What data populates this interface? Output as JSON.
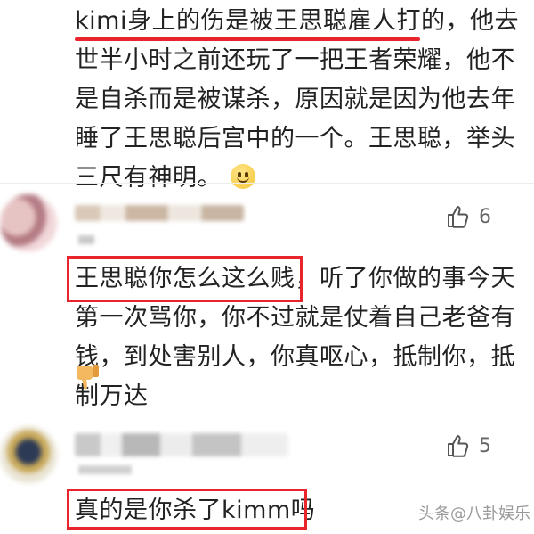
{
  "comments": [
    {
      "text": "kimi身上的伤是被王思聪雇人打的，他去世半小时之前还玩了一把王者荣耀，他不是自杀而是被谋杀，原因就是因为他去年睡了王思聪后宫中的一个。王思聪，举头三尺有神明。",
      "emoji": "smile-emoji"
    },
    {
      "text": "王思聪你怎么这么贱，听了你做的事今天第一次骂你，你不过就是仗着自己老爸有钱，到处害别人，你真呕心，抵制你，抵制万达",
      "likes": "6",
      "emoji": "thumbs-down-emoji"
    },
    {
      "text": "真的是你杀了kimm吗",
      "likes": "5"
    }
  ],
  "watermark": {
    "prefix": "头条",
    "handle": "@八卦娱乐"
  },
  "colors": {
    "highlight": "#e8242c",
    "text": "#222222",
    "muted": "#666666"
  }
}
